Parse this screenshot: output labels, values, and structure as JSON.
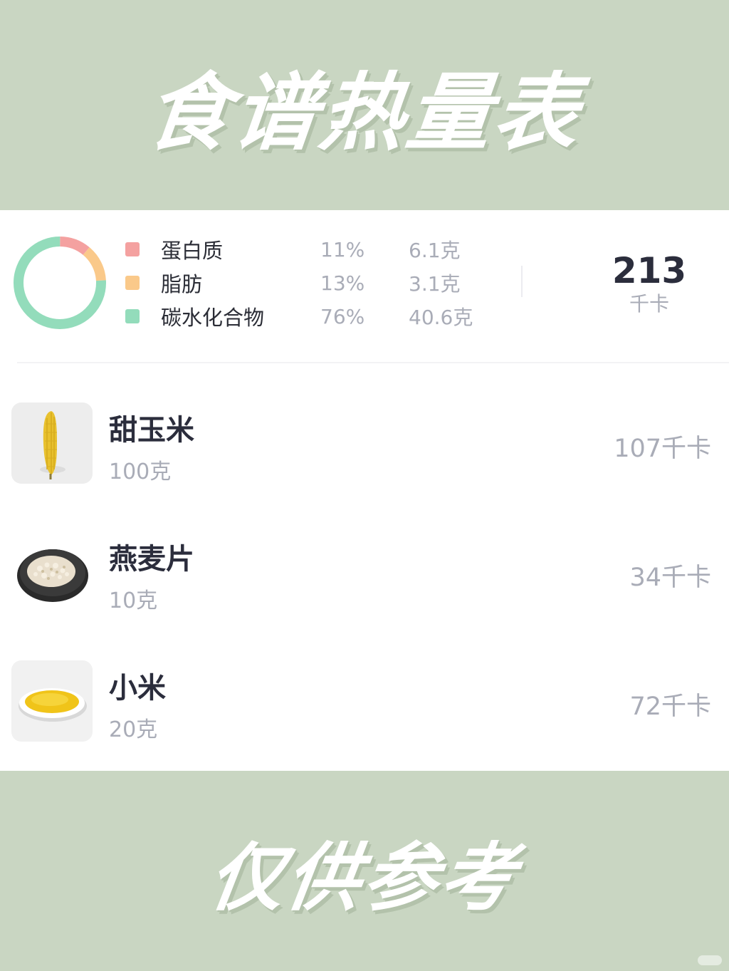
{
  "header": {
    "title": "食谱热量表"
  },
  "footer": {
    "text": "仅供参考"
  },
  "summary": {
    "macros": [
      {
        "name": "蛋白质",
        "percent": "11%",
        "amount": "6.1克",
        "color": "#f4a1a0",
        "share": 11
      },
      {
        "name": "脂肪",
        "percent": "13%",
        "amount": "3.1克",
        "color": "#fac98a",
        "share": 13
      },
      {
        "name": "碳水化合物",
        "percent": "76%",
        "amount": "40.6克",
        "color": "#93dcbb",
        "share": 76
      }
    ],
    "total_value": "213",
    "total_unit": "千卡"
  },
  "foods": [
    {
      "name": "甜玉米",
      "weight": "100克",
      "kcal": "107千卡",
      "image": "corn-image"
    },
    {
      "name": "燕麦片",
      "weight": "10克",
      "kcal": "34千卡",
      "image": "oats-image"
    },
    {
      "name": "小米",
      "weight": "20克",
      "kcal": "72千卡",
      "image": "millet-image"
    }
  ]
}
